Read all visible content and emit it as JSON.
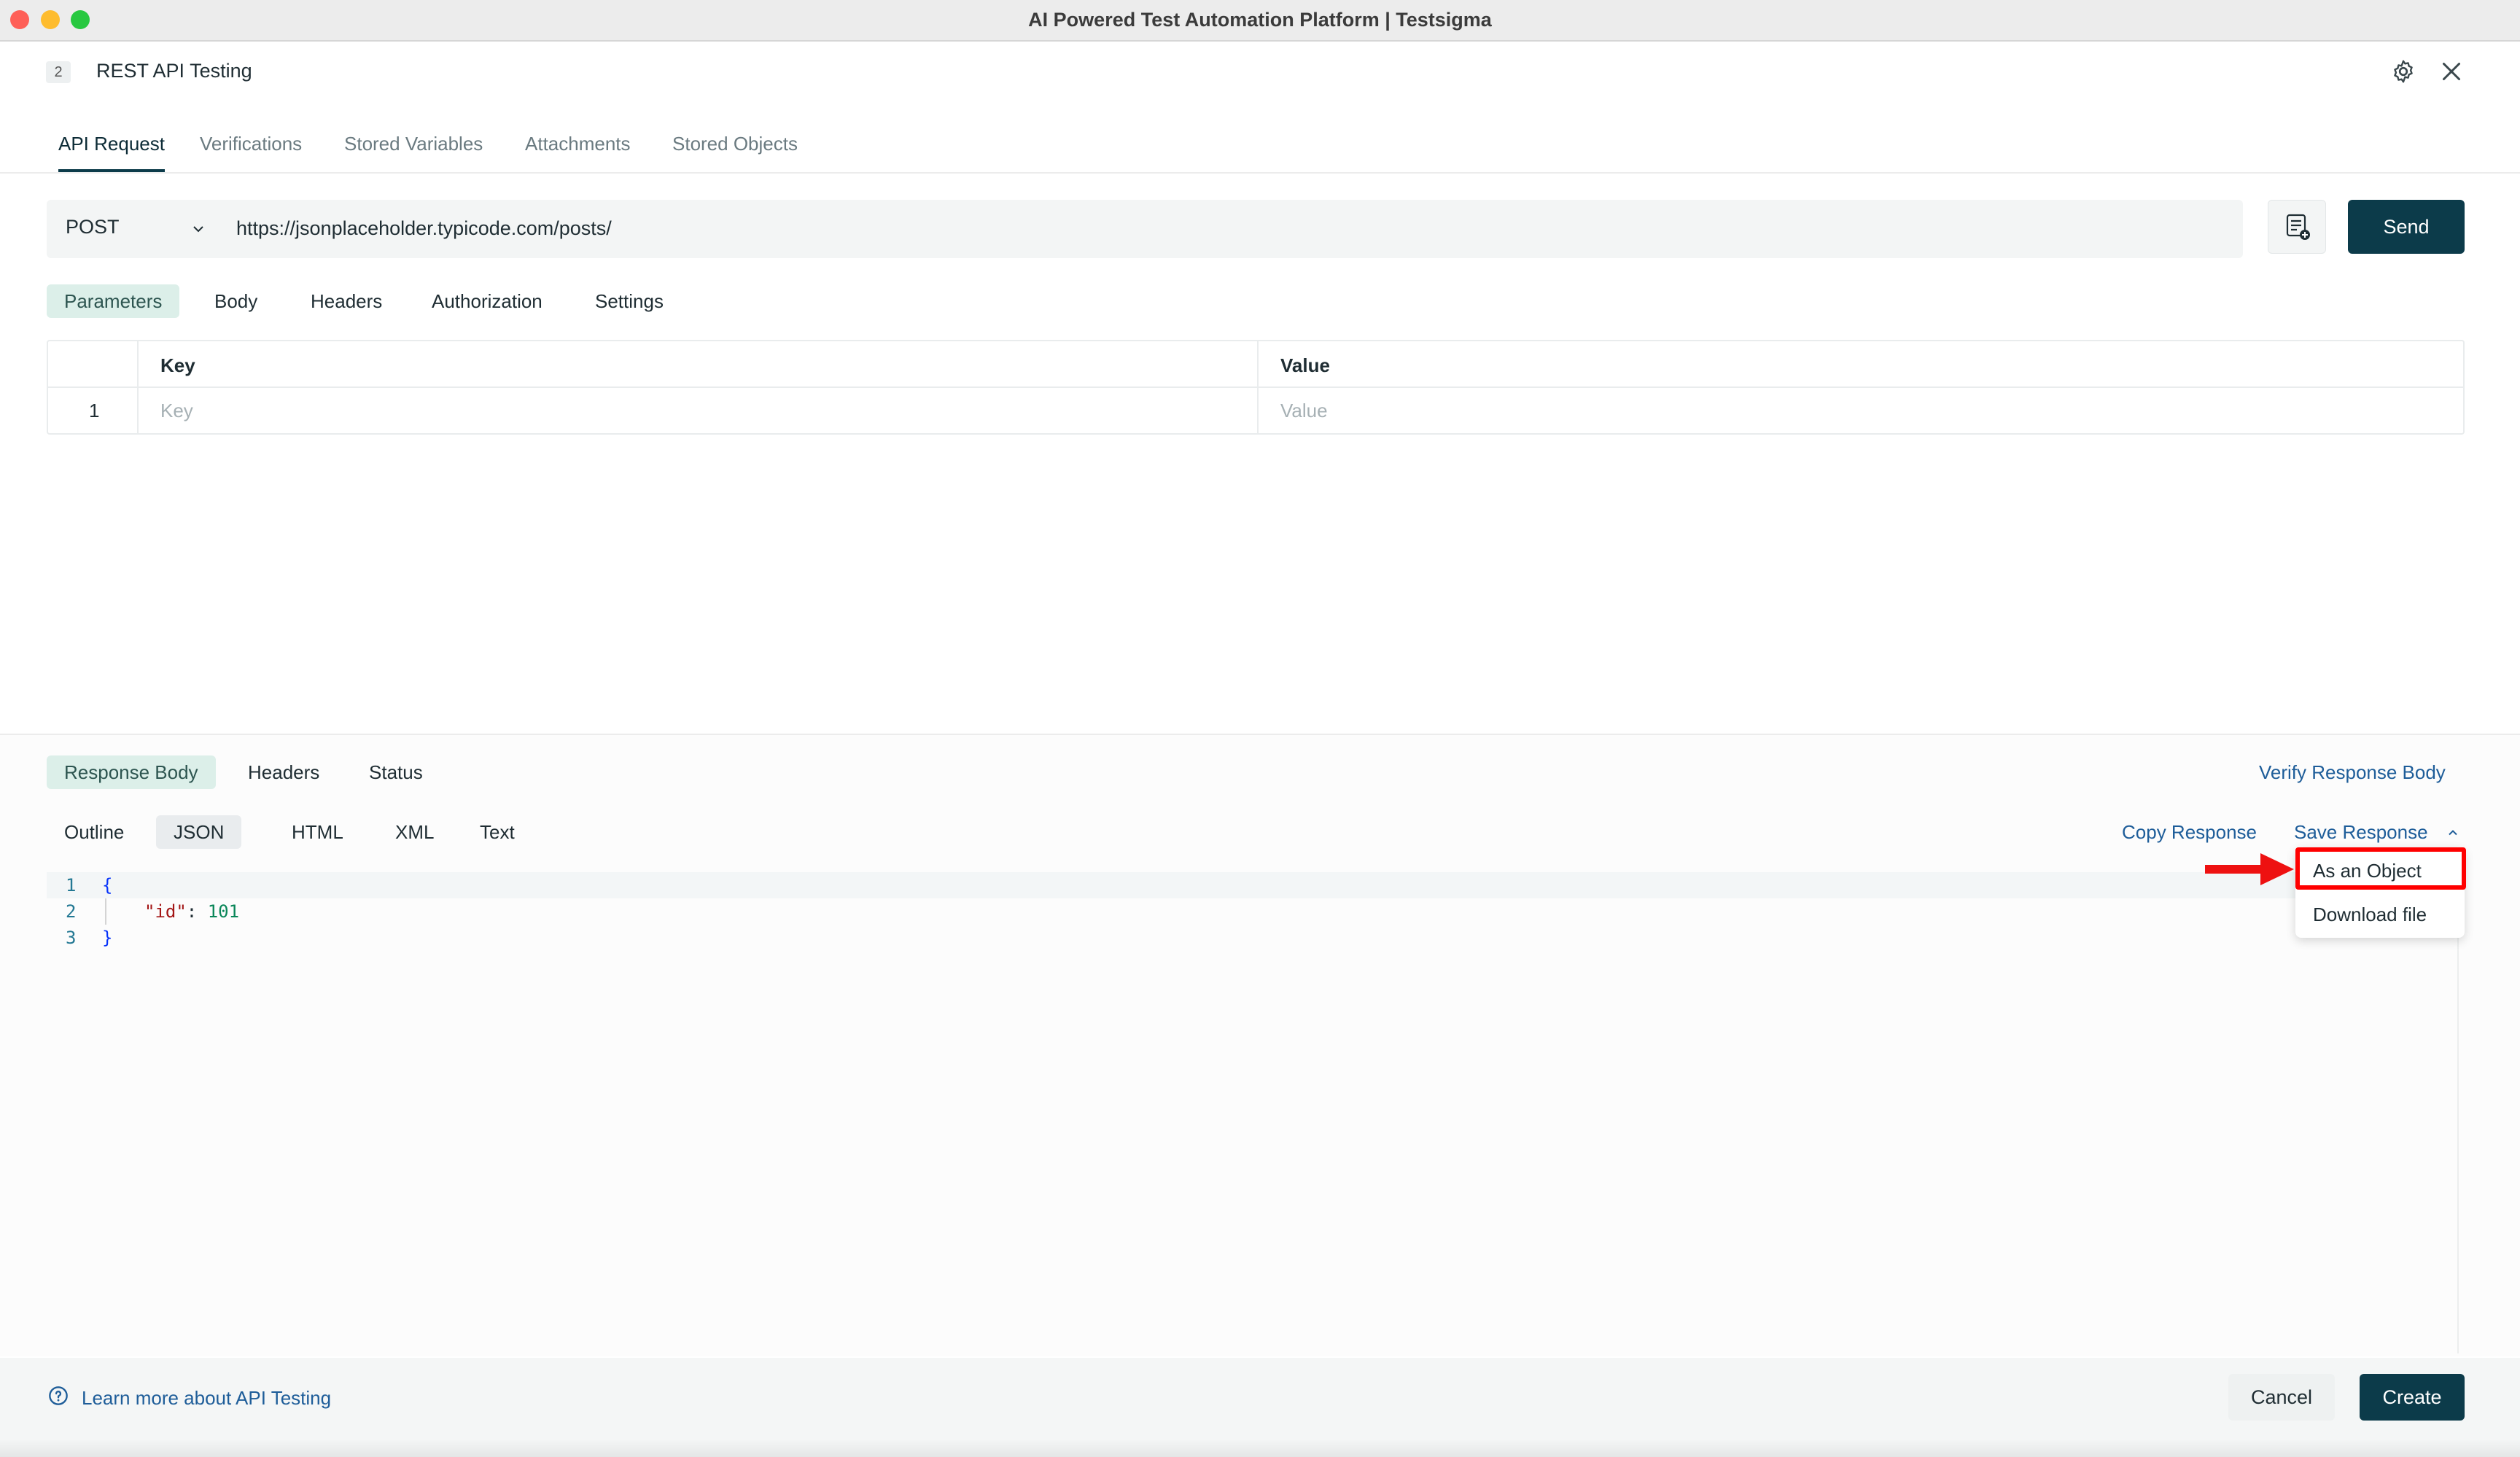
{
  "window": {
    "title": "AI Powered Test Automation Platform | Testsigma"
  },
  "header": {
    "step_number": "2",
    "title": "REST API Testing"
  },
  "tabs": [
    {
      "label": "API Request"
    },
    {
      "label": "Verifications"
    },
    {
      "label": "Stored Variables"
    },
    {
      "label": "Attachments"
    },
    {
      "label": "Stored Objects"
    }
  ],
  "request": {
    "method": "POST",
    "url": "https://jsonplaceholder.typicode.com/posts/",
    "send_label": "Send"
  },
  "subtabs": [
    {
      "label": "Parameters"
    },
    {
      "label": "Body"
    },
    {
      "label": "Headers"
    },
    {
      "label": "Authorization"
    },
    {
      "label": "Settings"
    }
  ],
  "params_table": {
    "columns": [
      "Key",
      "Value"
    ],
    "rows": [
      {
        "index": "1",
        "key_placeholder": "Key",
        "value_placeholder": "Value"
      }
    ]
  },
  "response": {
    "tabs": [
      {
        "label": "Response Body"
      },
      {
        "label": "Headers"
      },
      {
        "label": "Status"
      }
    ],
    "verify_label": "Verify Response Body",
    "formats": [
      {
        "label": "Outline"
      },
      {
        "label": "JSON"
      },
      {
        "label": "HTML"
      },
      {
        "label": "XML"
      },
      {
        "label": "Text"
      }
    ],
    "copy_label": "Copy Response",
    "save_label": "Save Response",
    "save_menu": [
      {
        "label": "As an Object"
      },
      {
        "label": "Download file"
      }
    ],
    "code_lines": [
      {
        "n": "1",
        "brace": "{"
      },
      {
        "n": "2",
        "key": "\"id\"",
        "colon": ": ",
        "value": "101"
      },
      {
        "n": "3",
        "brace": "}"
      }
    ]
  },
  "footer": {
    "learn_label": "Learn more about API Testing",
    "cancel_label": "Cancel",
    "create_label": "Create"
  },
  "colors": {
    "primary": "#0c3b4a",
    "link": "#1e5d99",
    "highlight": "#ff0000"
  }
}
